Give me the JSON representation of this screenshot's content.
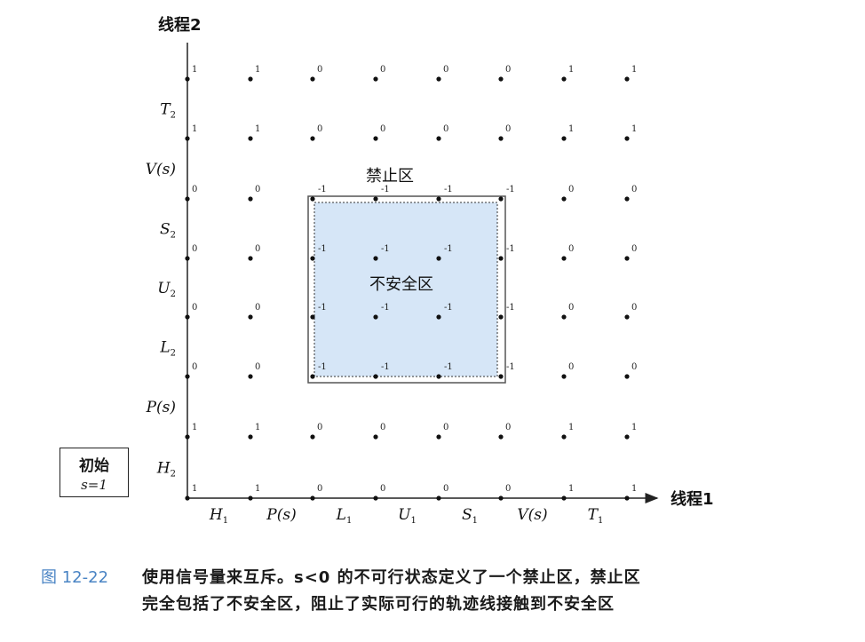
{
  "axes": {
    "y_title": "线程2",
    "x_title": "线程1"
  },
  "x_ticks": [
    {
      "main": "H",
      "sub": "1"
    },
    {
      "main": "P(s)",
      "sub": ""
    },
    {
      "main": "L",
      "sub": "1"
    },
    {
      "main": "U",
      "sub": "1"
    },
    {
      "main": "S",
      "sub": "1"
    },
    {
      "main": "V(s)",
      "sub": ""
    },
    {
      "main": "T",
      "sub": "1"
    }
  ],
  "y_ticks": [
    {
      "main": "H",
      "sub": "2"
    },
    {
      "main": "P(s)",
      "sub": ""
    },
    {
      "main": "L",
      "sub": "2"
    },
    {
      "main": "U",
      "sub": "2"
    },
    {
      "main": "S",
      "sub": "2"
    },
    {
      "main": "V(s)",
      "sub": ""
    },
    {
      "main": "T",
      "sub": "2"
    }
  ],
  "semaphore_values": [
    [
      "1",
      "1",
      "0",
      "0",
      "0",
      "0",
      "1",
      "1"
    ],
    [
      "1",
      "1",
      "0",
      "0",
      "0",
      "0",
      "1",
      "1"
    ],
    [
      "0",
      "0",
      "-1",
      "-1",
      "-1",
      "-1",
      "0",
      "0"
    ],
    [
      "0",
      "0",
      "-1",
      "-1",
      "-1",
      "-1",
      "0",
      "0"
    ],
    [
      "0",
      "0",
      "-1",
      "-1",
      "-1",
      "-1",
      "0",
      "0"
    ],
    [
      "0",
      "0",
      "-1",
      "-1",
      "-1",
      "-1",
      "0",
      "0"
    ],
    [
      "1",
      "1",
      "0",
      "0",
      "0",
      "0",
      "1",
      "1"
    ],
    [
      "1",
      "1",
      "0",
      "0",
      "0",
      "0",
      "1",
      "1"
    ]
  ],
  "regions": {
    "forbidden_label": "禁止区",
    "unsafe_label": "不安全区"
  },
  "initial_box": {
    "line1": "初始",
    "line2": "s=1"
  },
  "caption": {
    "figure_number": "图 12-22",
    "line1": "使用信号量来互斥。s<0 的不可行状态定义了一个禁止区，禁止区",
    "line2": "完全包括了不安全区，阻止了实际可行的轨迹线接触到不安全区"
  },
  "colors": {
    "unsafe_fill": "#d6e6f7",
    "axis": "#222222",
    "caption_number": "#4a84c4"
  }
}
